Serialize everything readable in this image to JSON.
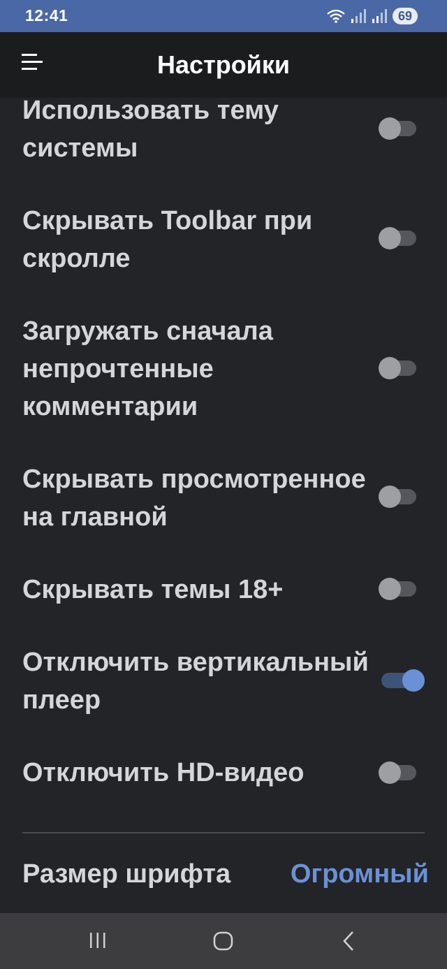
{
  "status_bar": {
    "time": "12:41",
    "battery_level": "69",
    "icons": [
      "wifi-icon",
      "signal-icon",
      "signal-roaming-icon",
      "battery-icon"
    ]
  },
  "app_bar": {
    "title": "Настройки",
    "menu_icon": "hamburger-menu-icon"
  },
  "settings": [
    {
      "label": "Использовать тему системы",
      "enabled": false
    },
    {
      "label": "Скрывать Toolbar при скролле",
      "enabled": false
    },
    {
      "label": "Загружать сначала непрочтенные комментарии",
      "enabled": false
    },
    {
      "label": "Скрывать просмотренное на главной",
      "enabled": false
    },
    {
      "label": "Скрывать темы 18+",
      "enabled": false
    },
    {
      "label": "Отключить вертикальный плеер",
      "enabled": true
    },
    {
      "label": "Отключить HD-видео",
      "enabled": false
    }
  ],
  "font_size": {
    "label": "Размер шрифта",
    "value": "Огромный"
  },
  "nav_bar": {
    "icons": [
      "recent-apps-icon",
      "home-icon",
      "back-icon"
    ]
  },
  "colors": {
    "status_bar": "#4a68a5",
    "background": "#232427",
    "accent": "#6a91d6"
  }
}
